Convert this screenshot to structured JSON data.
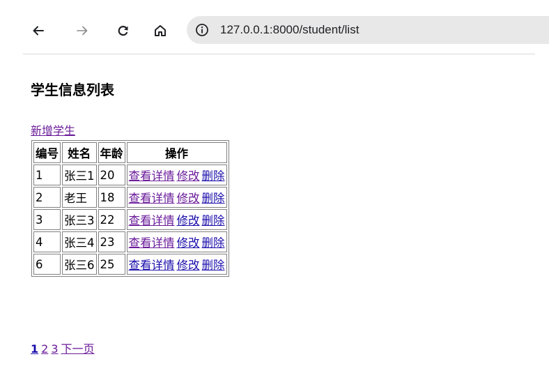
{
  "browser": {
    "url": "127.0.0.1:8000/student/list",
    "icons": [
      "back-icon",
      "forward-icon",
      "reload-icon",
      "home-icon",
      "info-icon"
    ]
  },
  "page": {
    "title": "学生信息列表",
    "add_link": "新增学生"
  },
  "table": {
    "headers": [
      "编号",
      "姓名",
      "年龄",
      "操作"
    ],
    "rows": [
      {
        "id": "1",
        "name": "张三1",
        "age": "20"
      },
      {
        "id": "2",
        "name": "老王",
        "age": "18"
      },
      {
        "id": "3",
        "name": "张三3",
        "age": "22"
      },
      {
        "id": "4",
        "name": "张三4",
        "age": "23"
      },
      {
        "id": "6",
        "name": "张三6",
        "age": "25"
      }
    ],
    "actions": {
      "view": "查看详情",
      "edit": "修改",
      "delete": "删除"
    }
  },
  "pagination": {
    "pages": [
      "1",
      "2",
      "3"
    ],
    "current": "1",
    "next": "下一页"
  },
  "colors": {
    "visited_link": "#6a1b9a",
    "link": "#1a0dab",
    "address_bar": "#e8e8e8"
  }
}
